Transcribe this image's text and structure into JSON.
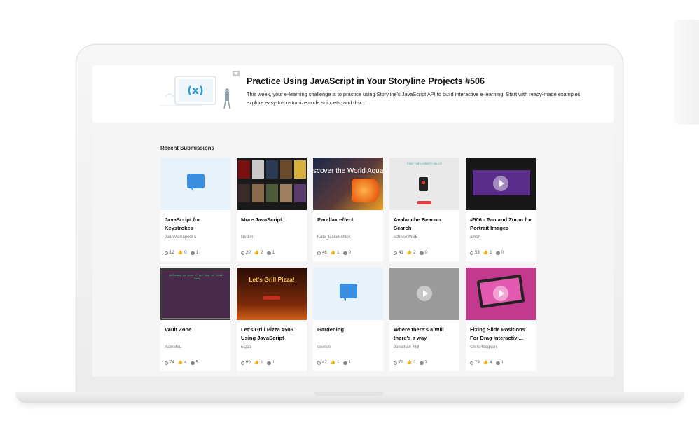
{
  "banner": {
    "title": "Practice Using JavaScript in Your Storyline Projects #506",
    "description": "This week, your e-learning challenge is to practice using Storyline’s JavaScript API to build interactive e-learning. Start with ready-made examples, explore easy-to-customize code snippets, and disc...",
    "art_text": "(x)"
  },
  "section_title": "Recent Submissions",
  "cards": [
    {
      "title": "JavaScript for Keystrokes",
      "author": "JeanMarrapodi-c",
      "views": "12",
      "likes": "0",
      "comments": "1",
      "thumb": "chat-icon"
    },
    {
      "title": "More JavaScript...",
      "author": "Nedim",
      "views": "20",
      "likes": "2",
      "comments": "1",
      "thumb": "movie-posters"
    },
    {
      "title": "Parallax effect",
      "author": "Kate_Golomshtok",
      "views": "46",
      "likes": "1",
      "comments": "0",
      "thumb": "aquarium",
      "thumb_text": "scover the World Aquariums"
    },
    {
      "title": "Avalanche Beacon Search",
      "author": "schneeWISE",
      "views": "41",
      "likes": "2",
      "comments": "0",
      "thumb": "beacon",
      "thumb_text": "FIND THE LOWEST VALUE"
    },
    {
      "title": "#506 - Pan and Zoom for Portrait Images",
      "author": "amon",
      "views": "53",
      "likes": "1",
      "comments": "0",
      "thumb": "video-dark"
    },
    {
      "title": "Vault Zone",
      "author": "KateMau",
      "views": "74",
      "likes": "4",
      "comments": "5",
      "thumb": "vault",
      "thumb_text": "Welcome to your first day at Vault Zone"
    },
    {
      "title": "Let's Grill Pizza #506 Using JavaScript",
      "author": "EQ23",
      "views": "69",
      "likes": "1",
      "comments": "1",
      "thumb": "pizza",
      "thumb_text": "Let's Grill Pizza!"
    },
    {
      "title": "Gardening",
      "author": "cserkin",
      "views": "47",
      "likes": "1",
      "comments": "1",
      "thumb": "chat-icon"
    },
    {
      "title": "Where there's a Will there's a way",
      "author": "Jonathan_Hill",
      "views": "79",
      "likes": "3",
      "comments": "3",
      "thumb": "video-grey"
    },
    {
      "title": "Fixing Slide Positions For Drag Interactivi...",
      "author": "ChrisHodgson",
      "views": "79",
      "likes": "4",
      "comments": "1",
      "thumb": "tablet-hands"
    }
  ],
  "colors": {
    "accent": "#3b8fe0",
    "screen_bg": "#f5f5f5"
  }
}
